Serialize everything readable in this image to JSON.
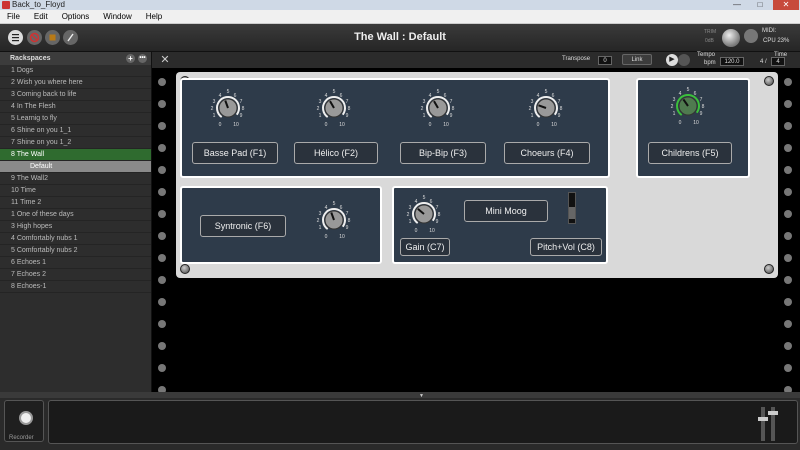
{
  "window": {
    "title": "Back_to_Floyd",
    "min": "—",
    "max": "□",
    "close": "✕"
  },
  "menu": [
    "File",
    "Edit",
    "Options",
    "Window",
    "Help"
  ],
  "toolbar": {
    "title": "The Wall : Default",
    "midi_label": "MIDI:",
    "cpu_label": "CPU 23%",
    "trim_label": "TRIM",
    "trim_value": "0dB"
  },
  "sidebar": {
    "header": "Rackspaces",
    "items": [
      {
        "label": "1 Dogs",
        "state": "normal"
      },
      {
        "label": "2 Wish you where here",
        "state": "normal"
      },
      {
        "label": "3 Coming back to life",
        "state": "normal"
      },
      {
        "label": "4 In The Flesh",
        "state": "normal"
      },
      {
        "label": "5 Learnig to fly",
        "state": "normal"
      },
      {
        "label": "6 Shine on you 1_1",
        "state": "normal"
      },
      {
        "label": "7 Shine on you 1_2",
        "state": "normal"
      },
      {
        "label": "8 The Wall",
        "state": "active"
      },
      {
        "label": "Default",
        "state": "variation"
      },
      {
        "label": "9 The Wall2",
        "state": "normal"
      },
      {
        "label": "10 Time",
        "state": "normal"
      },
      {
        "label": "11 Time 2",
        "state": "normal"
      },
      {
        "label": "1 One of these days",
        "state": "normal"
      },
      {
        "label": "3 High hopes",
        "state": "normal"
      },
      {
        "label": "4 Comfortably nubs 1",
        "state": "normal"
      },
      {
        "label": "5 Comfortably nubs 2",
        "state": "normal"
      },
      {
        "label": "6 Echoes 1",
        "state": "normal"
      },
      {
        "label": "7 Echoes 2",
        "state": "normal"
      },
      {
        "label": "8 Echoes-1",
        "state": "normal"
      }
    ]
  },
  "subbar": {
    "transpose_label": "Transpose",
    "transpose_value": "0",
    "link_label": "Link",
    "tempo_label": "Tempo",
    "bpm_label": "bpm",
    "tempo_value": "120.0",
    "time_label": "Time",
    "time_num": "4",
    "time_slash": "/",
    "time_den": "4"
  },
  "rack": {
    "buttons": {
      "f1": "Basse Pad (F1)",
      "f2": "Hélico (F2)",
      "f3": "Bip-Bip (F3)",
      "f4": "Choeurs (F4)",
      "f5": "Childrens (F5)",
      "f6": "Syntronic (F6)",
      "c7": "Gain (C7)",
      "moog": "Mini Moog",
      "c8": "Pitch+Vol (C8)"
    },
    "knob_scale": [
      "1",
      "2",
      "3",
      "4",
      "5",
      "6",
      "7",
      "8",
      "9",
      "0",
      "10"
    ],
    "colors": {
      "panel_bg": "#2e3b4a",
      "active_green": "#2f6b2f",
      "knob_ring_green": "#3bbf3b"
    }
  },
  "bottom": {
    "recorder_label": "Recorder"
  }
}
